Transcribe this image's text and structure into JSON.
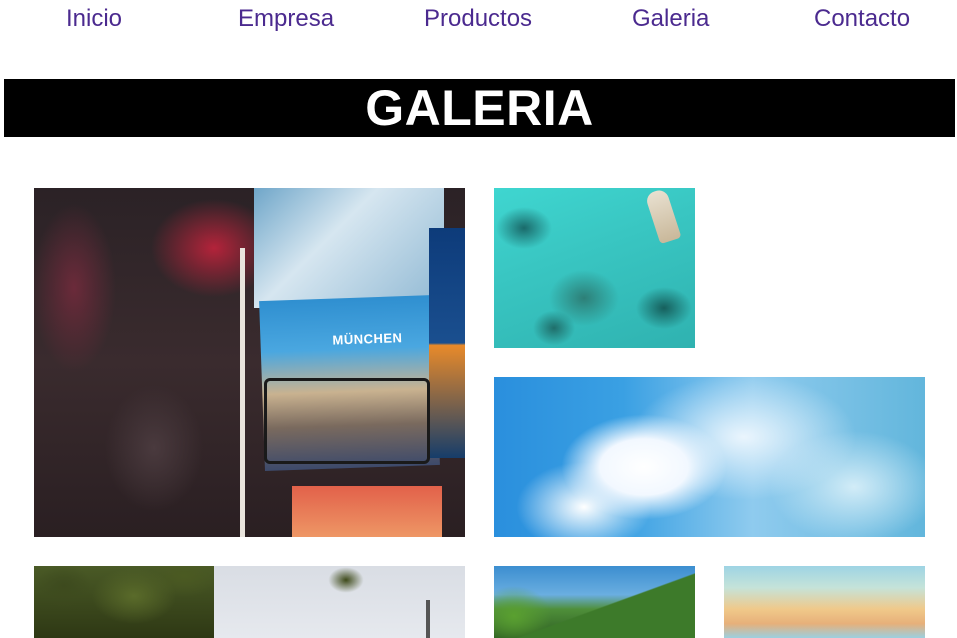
{
  "nav": {
    "items": [
      {
        "label": "Inicio"
      },
      {
        "label": "Empresa"
      },
      {
        "label": "Productos"
      },
      {
        "label": "Galeria"
      },
      {
        "label": "Contacto"
      }
    ]
  },
  "banner": {
    "title": "GALERIA"
  },
  "gallery": {
    "postcard_text": "MÜNCHEN",
    "images": [
      {
        "subject": "postcards-stand"
      },
      {
        "subject": "turquoise-sea-aerial"
      },
      {
        "subject": "sky-clouds"
      },
      {
        "subject": "tree-and-tower"
      },
      {
        "subject": "green-hills"
      },
      {
        "subject": "sunset-sky"
      }
    ]
  },
  "colors": {
    "nav_link": "#4b2a8f",
    "banner_bg": "#000000",
    "banner_text": "#ffffff"
  }
}
